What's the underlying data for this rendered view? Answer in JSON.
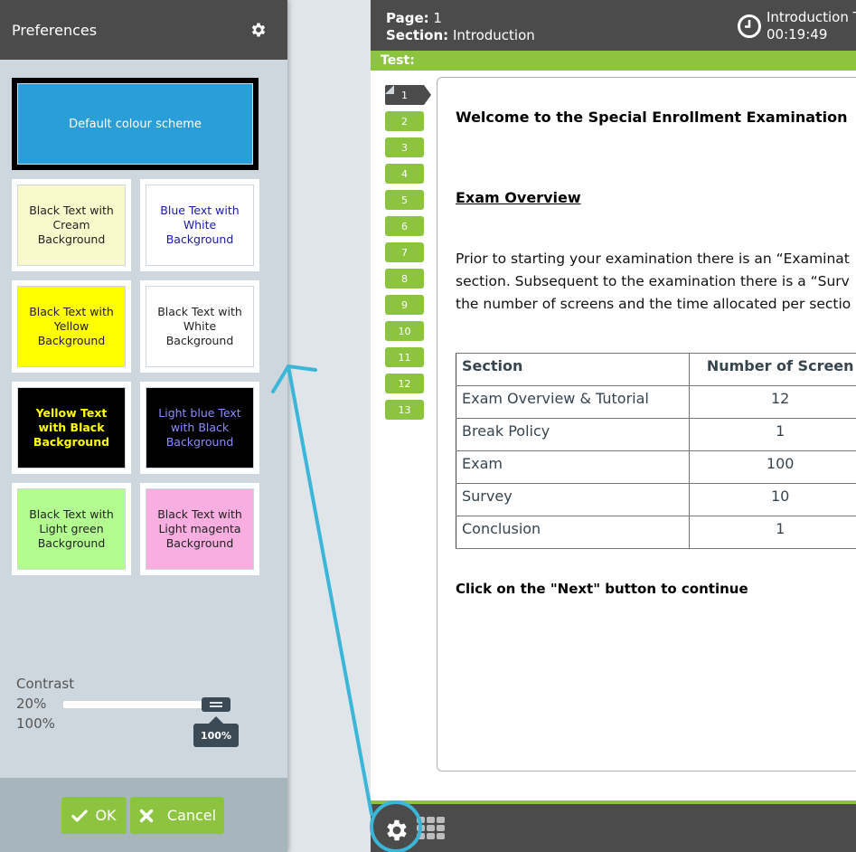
{
  "preferences": {
    "title": "Preferences",
    "header_icon": "gear-icon",
    "default_scheme": {
      "label": "Default colour scheme",
      "bg": "#2a9ed8",
      "fg": "#ffffff",
      "selected": true
    },
    "schemes": [
      {
        "label": "Black Text with Cream Background",
        "bg": "#f9f9cc",
        "fg": "#222222"
      },
      {
        "label": "Blue Text with White Background",
        "bg": "#ffffff",
        "fg": "#1a1aa0"
      },
      {
        "label": "Black Text with Yellow Background",
        "bg": "#ffff00",
        "fg": "#222222"
      },
      {
        "label": "Black Text with White Background",
        "bg": "#ffffff",
        "fg": "#222222"
      },
      {
        "label": "Yellow Text with Black Background",
        "bg": "#000000",
        "fg": "#ffff00"
      },
      {
        "label": "Light blue Text with Black Background",
        "bg": "#000000",
        "fg": "#8c8cff"
      },
      {
        "label": "Black Text with Light green Background",
        "bg": "#b3fd90",
        "fg": "#222222"
      },
      {
        "label": "Black Text with Light magenta Background",
        "bg": "#f8aee0",
        "fg": "#222222"
      }
    ],
    "contrast": {
      "label": "Contrast",
      "min_label": "20%",
      "max_label": "100%",
      "value_percent": 100,
      "tooltip": "100%"
    },
    "ok_label": "OK",
    "cancel_label": "Cancel"
  },
  "exam": {
    "page_label": "Page:",
    "page_value": "1",
    "section_label": "Section:",
    "section_value": "Introduction",
    "timer_title": "Introduction T",
    "timer_value": "00:19:49",
    "test_label": "Test:",
    "nav_items": [
      "1",
      "2",
      "3",
      "4",
      "5",
      "6",
      "7",
      "8",
      "9",
      "10",
      "11",
      "12",
      "13"
    ],
    "current_page": "1",
    "content": {
      "heading": "Welcome to the Special Enrollment Examination",
      "subheading": "Exam Overview",
      "paragraph_lines": [
        "Prior to starting your examination there is an “Examinat",
        "section. Subsequent to the examination there is a “Surv",
        "the number of screens and the time allocated per sectio"
      ],
      "table": {
        "headers": [
          "Section",
          "Number of Screen"
        ],
        "rows": [
          [
            "Exam Overview & Tutorial",
            "12"
          ],
          [
            "Break Policy",
            "1"
          ],
          [
            "Exam",
            "100"
          ],
          [
            "Survey",
            "10"
          ],
          [
            "Conclusion",
            "1"
          ]
        ]
      },
      "next_hint": "Click on the \"Next\" button to continue"
    },
    "footer_icons": [
      "gear-icon",
      "grid-icon"
    ]
  },
  "colors": {
    "accent_green": "#8cc43f",
    "header_dark": "#4b4b4b",
    "annotation_blue": "#3bb6d8"
  }
}
